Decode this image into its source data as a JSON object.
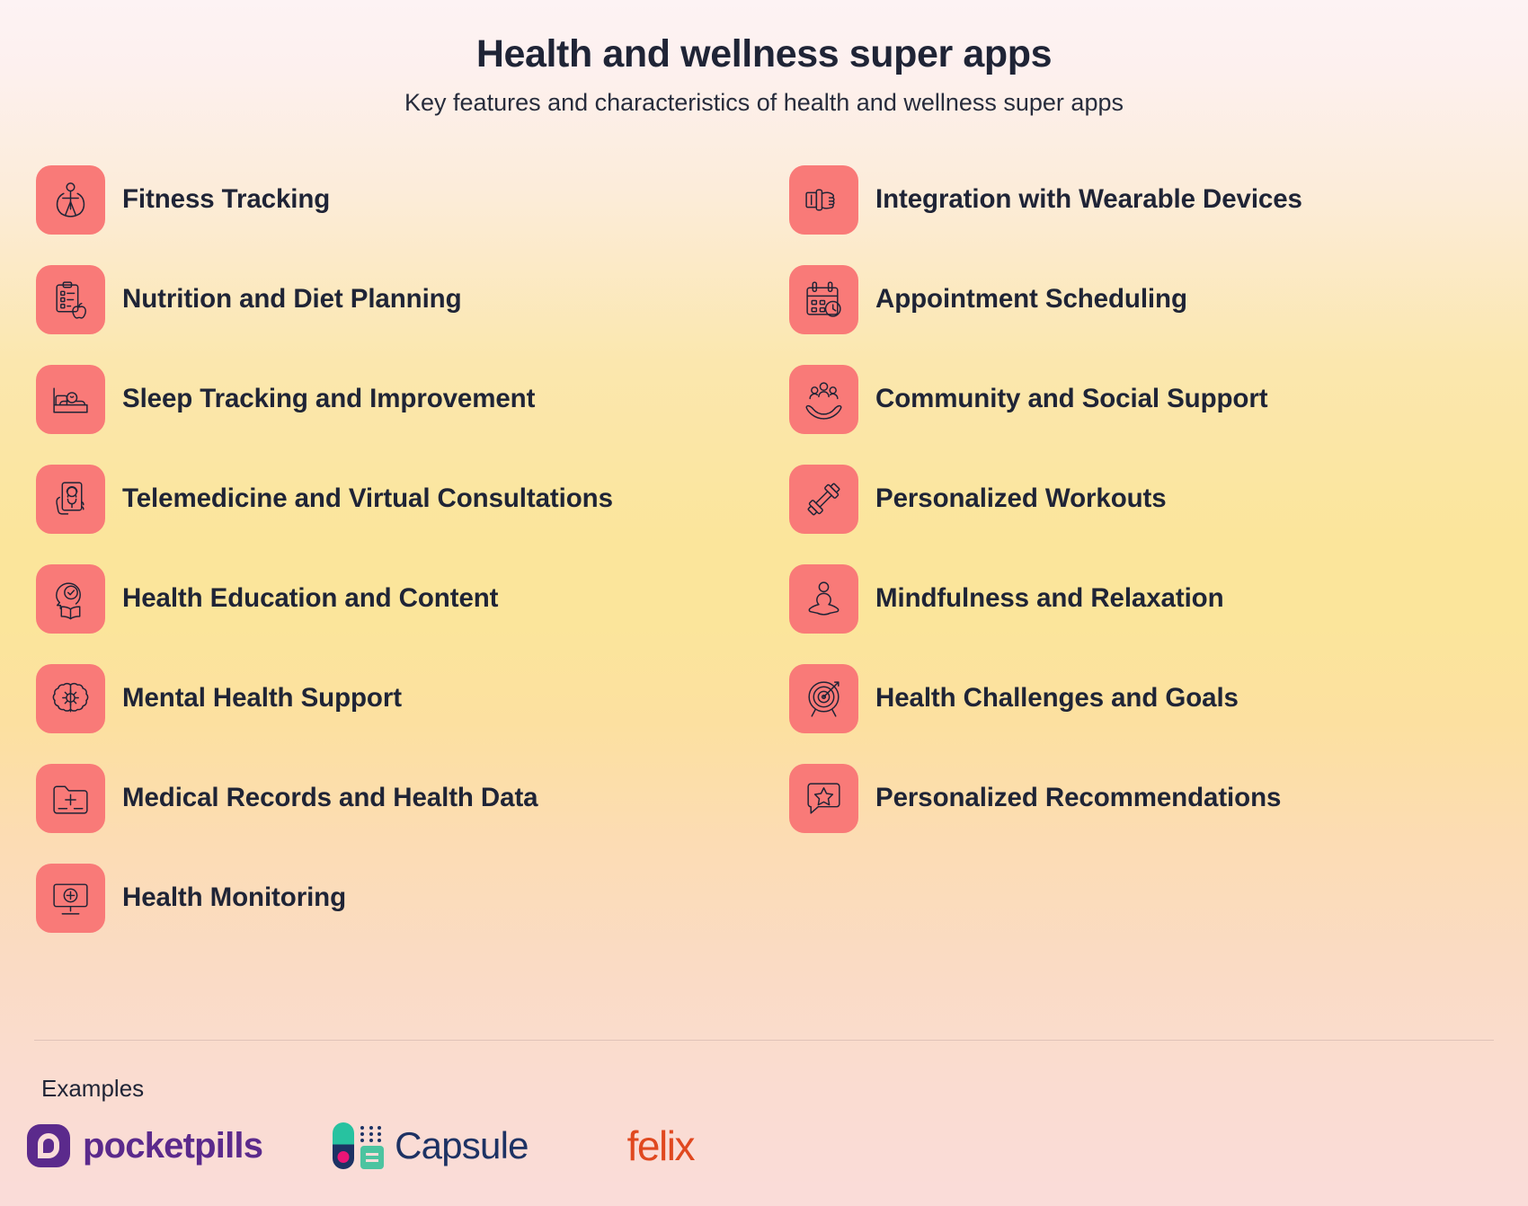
{
  "header": {
    "title": "Health and wellness super apps",
    "subtitle": "Key features and characteristics of health and wellness super apps"
  },
  "colors": {
    "icon_tile": "#f97a78",
    "text": "#1f2436",
    "divider": "#dfc3b8",
    "bg_top": "#fdf3f4",
    "bg_mid": "#fbe59b",
    "bg_bottom": "#fadcd9"
  },
  "features_left": [
    {
      "label": "Fitness Tracking",
      "icon": "person-jump-rope-icon"
    },
    {
      "label": "Nutrition and Diet Planning",
      "icon": "clipboard-apple-icon"
    },
    {
      "label": "Sleep Tracking and Improvement",
      "icon": "person-sleeping-bed-icon"
    },
    {
      "label": "Telemedicine and Virtual Consultations",
      "icon": "hand-phone-doctor-icon"
    },
    {
      "label": "Health Education and Content",
      "icon": "head-check-book-icon"
    },
    {
      "label": "Mental Health Support",
      "icon": "brain-gear-icon"
    },
    {
      "label": "Medical Records and Health Data",
      "icon": "folder-plus-icon"
    },
    {
      "label": "Health Monitoring",
      "icon": "monitor-heart-icon"
    }
  ],
  "features_right": [
    {
      "label": "Integration with Wearable Devices",
      "icon": "wrist-smartwatch-icon"
    },
    {
      "label": "Appointment Scheduling",
      "icon": "calendar-clock-icon"
    },
    {
      "label": "Community and Social Support",
      "icon": "hands-group-people-icon"
    },
    {
      "label": "Personalized Workouts",
      "icon": "dumbbell-icon"
    },
    {
      "label": "Mindfulness and Relaxation",
      "icon": "meditation-lotus-icon"
    },
    {
      "label": "Health Challenges and Goals",
      "icon": "target-arrow-icon"
    },
    {
      "label": "Personalized Recommendations",
      "icon": "chat-bubble-star-icon"
    }
  ],
  "footer": {
    "examples_label": "Examples",
    "logos": [
      {
        "name": "pocketpills",
        "word": "pocketpills",
        "color": "#5b2a8c"
      },
      {
        "name": "capsule",
        "word": "Capsule",
        "color": "#1d3264"
      },
      {
        "name": "felix",
        "word": "felix",
        "color": "#e0481f"
      }
    ]
  }
}
